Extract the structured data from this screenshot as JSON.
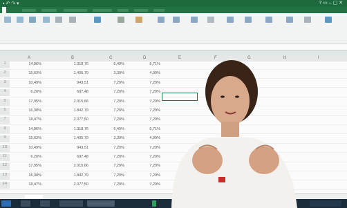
{
  "colors": {
    "excel_green": "#217346",
    "ribbon_bg": "#f2f4f3",
    "taskbar": "#1b2b3a"
  },
  "columns": [
    "A",
    "B",
    "C",
    "D",
    "E",
    "F",
    "G",
    "H",
    "I"
  ],
  "rows": [
    {
      "n": "1",
      "a": "14,86%",
      "b": "1.318,76",
      "c": "6,49%",
      "d": "5,71%"
    },
    {
      "n": "2",
      "a": "15,63%",
      "b": "1.405,79",
      "c": "3,39%",
      "d": "4,99%"
    },
    {
      "n": "3",
      "a": "10,49%",
      "b": "943,51",
      "c": "7,29%",
      "d": "7,29%"
    },
    {
      "n": "4",
      "a": "6,20%",
      "b": "697,48",
      "c": "7,29%",
      "d": "7,29%"
    },
    {
      "n": "5",
      "a": "17,95%",
      "b": "2.015,66",
      "c": "7,29%",
      "d": "7,29%"
    },
    {
      "n": "6",
      "a": "16,38%",
      "b": "1.842,79",
      "c": "7,29%",
      "d": "7,29%"
    },
    {
      "n": "7",
      "a": "18,47%",
      "b": "2.077,50",
      "c": "7,29%",
      "d": "7,29%"
    },
    {
      "n": "8",
      "a": "14,86%",
      "b": "1.318,76",
      "c": "6,49%",
      "d": "5,71%"
    },
    {
      "n": "9",
      "a": "15,63%",
      "b": "1.405,79",
      "c": "3,39%",
      "d": "4,99%"
    },
    {
      "n": "10",
      "a": "10,49%",
      "b": "943,51",
      "c": "7,29%",
      "d": "7,29%"
    },
    {
      "n": "11",
      "a": "6,20%",
      "b": "697,48",
      "c": "7,29%",
      "d": "7,29%"
    },
    {
      "n": "12",
      "a": "17,95%",
      "b": "2.015,66",
      "c": "7,29%",
      "d": "7,29%"
    },
    {
      "n": "13",
      "a": "16,38%",
      "b": "1.842,79",
      "c": "7,29%",
      "d": "7,29%"
    },
    {
      "n": "14",
      "a": "18,47%",
      "b": "2.077,50",
      "c": "7,29%",
      "d": "7,29%"
    }
  ]
}
